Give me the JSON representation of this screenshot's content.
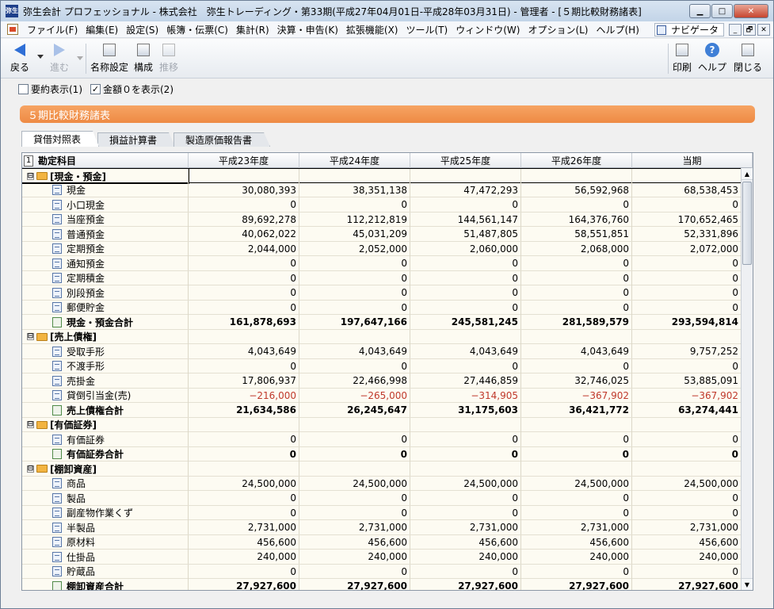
{
  "window": {
    "logo_text": "弥生",
    "title": "弥生会計 プロフェッショナル - 株式会社　弥生トレーディング・第33期(平成27年04月01日-平成28年03月31日) - 管理者 - [５期比較財務諸表]",
    "minimize": "▁",
    "maximize": "□",
    "close": "✕"
  },
  "menubar": {
    "items": [
      "ファイル(F)",
      "編集(E)",
      "設定(S)",
      "帳簿・伝票(C)",
      "集計(R)",
      "決算・申告(K)",
      "拡張機能(X)",
      "ツール(T)",
      "ウィンドウ(W)",
      "オプション(L)",
      "ヘルプ(H)"
    ],
    "navigator": "ナビゲータ",
    "mdi": [
      "_",
      "🗗",
      "✕"
    ]
  },
  "toolbar": {
    "back": "戻る",
    "forward": "進む",
    "name_settings": "名称設定",
    "structure": "構成",
    "trend": "推移",
    "print": "印刷",
    "help": "ヘルプ",
    "close": "閉じる",
    "help_glyph": "?"
  },
  "options": {
    "summary_label": "要約表示(1)",
    "summary_checked": false,
    "show_zero_label": "金額０を表示(2)",
    "show_zero_checked": true,
    "check_glyph": "✓"
  },
  "report": {
    "title": "５期比較財務諸表"
  },
  "tabs": [
    "貸借対照表",
    "損益計算書",
    "製造原価報告書"
  ],
  "grid": {
    "corner_num": "1",
    "columns": [
      "勘定科目",
      "平成23年度",
      "平成24年度",
      "平成25年度",
      "平成26年度",
      "当期"
    ],
    "scroll_up": "▲",
    "scroll_down": "▼",
    "rows": [
      {
        "type": "group",
        "label": "[現金・預金]",
        "expander": "⊟",
        "values": [
          "",
          "",
          "",
          "",
          ""
        ]
      },
      {
        "type": "account",
        "label": "現金",
        "values": [
          "30,080,393",
          "38,351,138",
          "47,472,293",
          "56,592,968",
          "68,538,453"
        ]
      },
      {
        "type": "account",
        "label": "小口現金",
        "values": [
          "0",
          "0",
          "0",
          "0",
          "0"
        ]
      },
      {
        "type": "account",
        "label": "当座預金",
        "values": [
          "89,692,278",
          "112,212,819",
          "144,561,147",
          "164,376,760",
          "170,652,465"
        ]
      },
      {
        "type": "account",
        "label": "普通預金",
        "values": [
          "40,062,022",
          "45,031,209",
          "51,487,805",
          "58,551,851",
          "52,331,896"
        ]
      },
      {
        "type": "account",
        "label": "定期預金",
        "values": [
          "2,044,000",
          "2,052,000",
          "2,060,000",
          "2,068,000",
          "2,072,000"
        ]
      },
      {
        "type": "account",
        "label": "通知預金",
        "values": [
          "0",
          "0",
          "0",
          "0",
          "0"
        ]
      },
      {
        "type": "account",
        "label": "定期積金",
        "values": [
          "0",
          "0",
          "0",
          "0",
          "0"
        ]
      },
      {
        "type": "account",
        "label": "別段預金",
        "values": [
          "0",
          "0",
          "0",
          "0",
          "0"
        ]
      },
      {
        "type": "account",
        "label": "郵便貯金",
        "values": [
          "0",
          "0",
          "0",
          "0",
          "0"
        ]
      },
      {
        "type": "total",
        "label": "現金・預金合計",
        "values": [
          "161,878,693",
          "197,647,166",
          "245,581,245",
          "281,589,579",
          "293,594,814"
        ]
      },
      {
        "type": "group",
        "label": "[売上債権]",
        "expander": "⊟",
        "values": [
          "",
          "",
          "",
          "",
          ""
        ]
      },
      {
        "type": "account",
        "label": "受取手形",
        "values": [
          "4,043,649",
          "4,043,649",
          "4,043,649",
          "4,043,649",
          "9,757,252"
        ]
      },
      {
        "type": "account",
        "label": "不渡手形",
        "values": [
          "0",
          "0",
          "0",
          "0",
          "0"
        ]
      },
      {
        "type": "account",
        "label": "売掛金",
        "values": [
          "17,806,937",
          "22,466,998",
          "27,446,859",
          "32,746,025",
          "53,885,091"
        ]
      },
      {
        "type": "account",
        "label": "貸倒引当金(売)",
        "negative": true,
        "values": [
          "−216,000",
          "−265,000",
          "−314,905",
          "−367,902",
          "−367,902"
        ]
      },
      {
        "type": "total",
        "label": "売上債権合計",
        "values": [
          "21,634,586",
          "26,245,647",
          "31,175,603",
          "36,421,772",
          "63,274,441"
        ]
      },
      {
        "type": "group",
        "label": "[有価証券]",
        "expander": "⊟",
        "values": [
          "",
          "",
          "",
          "",
          ""
        ]
      },
      {
        "type": "account",
        "label": "有価証券",
        "values": [
          "0",
          "0",
          "0",
          "0",
          "0"
        ]
      },
      {
        "type": "total",
        "label": "有価証券合計",
        "values": [
          "0",
          "0",
          "0",
          "0",
          "0"
        ]
      },
      {
        "type": "group",
        "label": "[棚卸資産]",
        "expander": "⊟",
        "values": [
          "",
          "",
          "",
          "",
          ""
        ]
      },
      {
        "type": "account",
        "label": "商品",
        "values": [
          "24,500,000",
          "24,500,000",
          "24,500,000",
          "24,500,000",
          "24,500,000"
        ]
      },
      {
        "type": "account",
        "label": "製品",
        "values": [
          "0",
          "0",
          "0",
          "0",
          "0"
        ]
      },
      {
        "type": "account",
        "label": "副産物作業くず",
        "values": [
          "0",
          "0",
          "0",
          "0",
          "0"
        ]
      },
      {
        "type": "account",
        "label": "半製品",
        "values": [
          "2,731,000",
          "2,731,000",
          "2,731,000",
          "2,731,000",
          "2,731,000"
        ]
      },
      {
        "type": "account",
        "label": "原材料",
        "values": [
          "456,600",
          "456,600",
          "456,600",
          "456,600",
          "456,600"
        ]
      },
      {
        "type": "account",
        "label": "仕掛品",
        "values": [
          "240,000",
          "240,000",
          "240,000",
          "240,000",
          "240,000"
        ]
      },
      {
        "type": "account",
        "label": "貯蔵品",
        "values": [
          "0",
          "0",
          "0",
          "0",
          "0"
        ]
      },
      {
        "type": "total",
        "label": "棚卸資産合計",
        "values": [
          "27,927,600",
          "27,927,600",
          "27,927,600",
          "27,927,600",
          "27,927,600"
        ]
      }
    ]
  }
}
